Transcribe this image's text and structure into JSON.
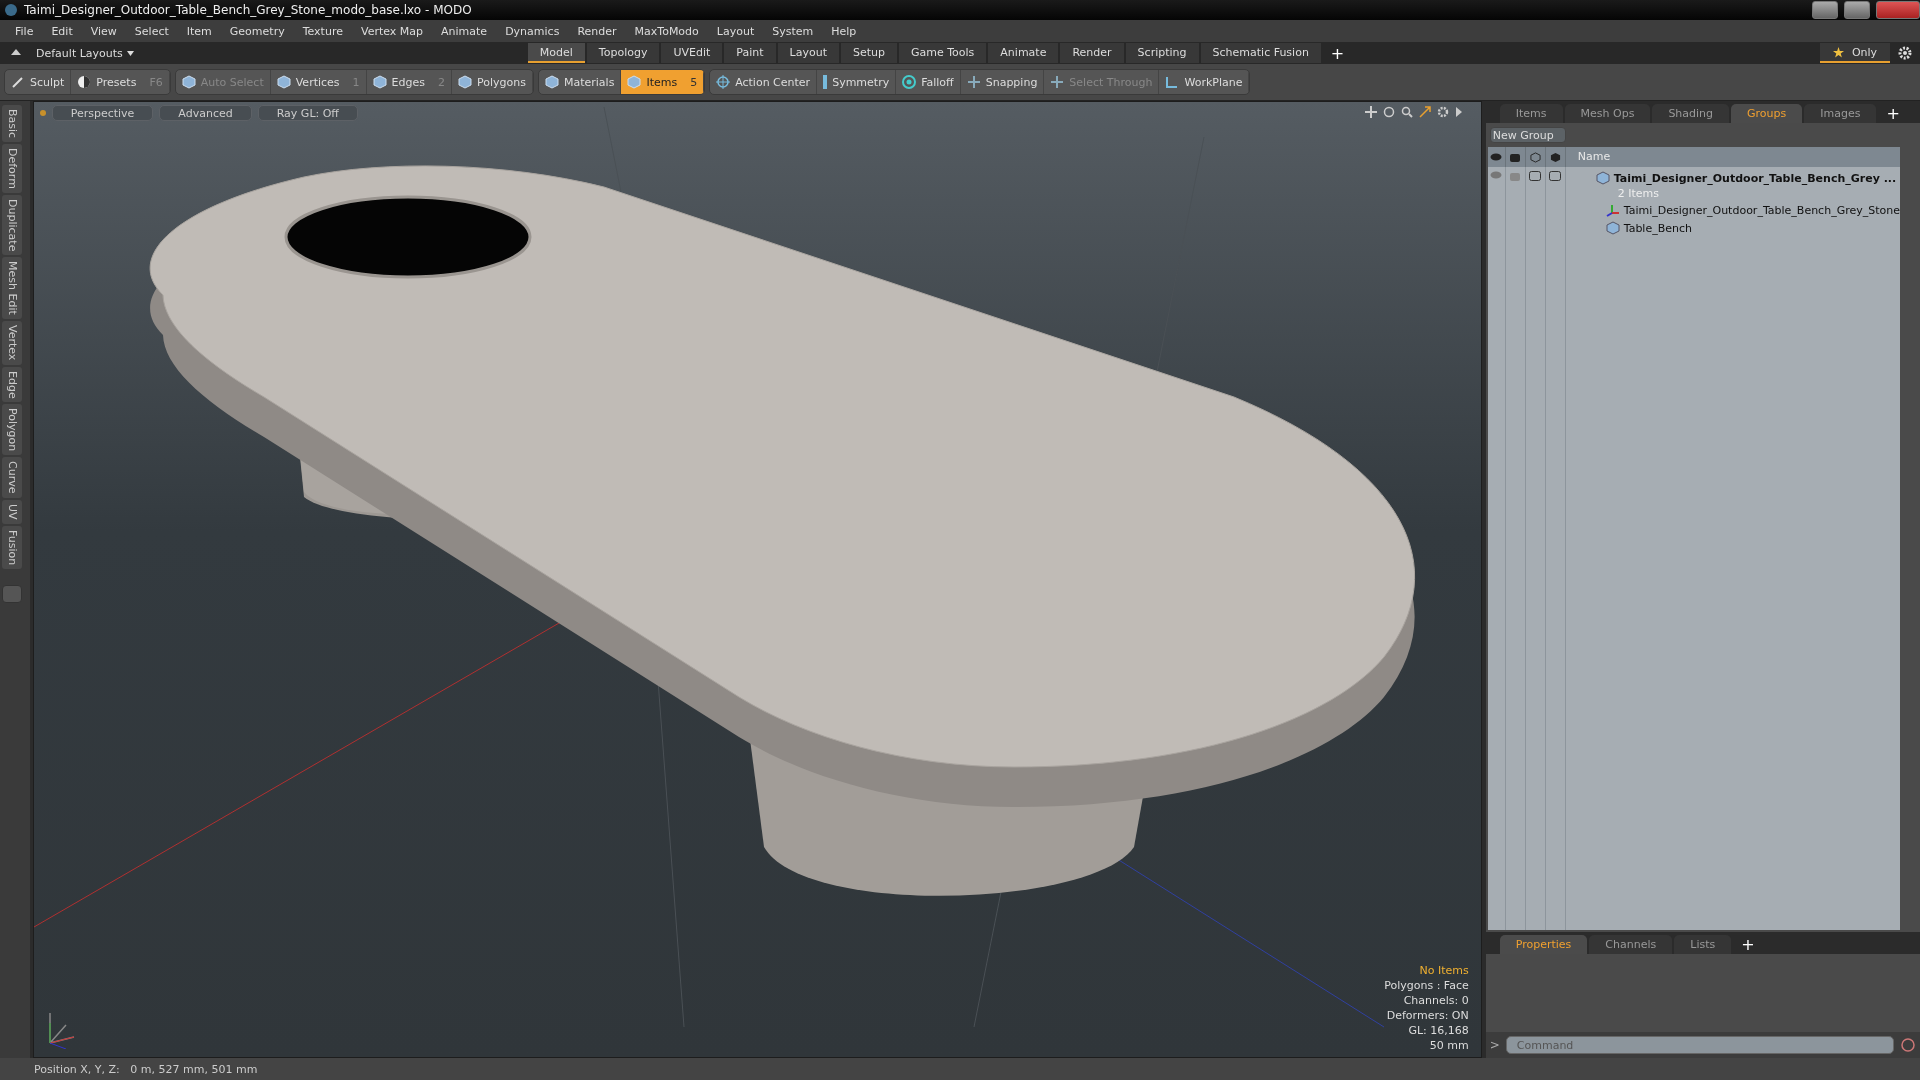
{
  "window": {
    "title": "Taimi_Designer_Outdoor_Table_Bench_Grey_Stone_modo_base.lxo - MODO"
  },
  "menu": [
    "File",
    "Edit",
    "View",
    "Select",
    "Item",
    "Geometry",
    "Texture",
    "Vertex Map",
    "Animate",
    "Dynamics",
    "Render",
    "MaxToModo",
    "Layout",
    "System",
    "Help"
  ],
  "layout_bar": {
    "layout_menu": "Default Layouts",
    "tabs": [
      {
        "label": "Model",
        "selected": true
      },
      {
        "label": "Topology",
        "selected": false
      },
      {
        "label": "UVEdit",
        "selected": false
      },
      {
        "label": "Paint",
        "selected": false
      },
      {
        "label": "Layout",
        "selected": false
      },
      {
        "label": "Setup",
        "selected": false
      },
      {
        "label": "Game Tools",
        "selected": false
      },
      {
        "label": "Animate",
        "selected": false
      },
      {
        "label": "Render",
        "selected": false
      },
      {
        "label": "Scripting",
        "selected": false
      },
      {
        "label": "Schematic Fusion",
        "selected": false
      }
    ],
    "add": "+",
    "only": "Only"
  },
  "toolbar": [
    [
      {
        "label": "Sculpt",
        "selected": false,
        "disabled": false
      },
      {
        "label": "Presets",
        "shortcut": "F6",
        "selected": false,
        "disabled": false
      }
    ],
    [
      {
        "label": "Auto Select",
        "selected": false,
        "disabled": true
      },
      {
        "label": "Vertices",
        "shortcut": "1",
        "selected": false,
        "disabled": false
      },
      {
        "label": "Edges",
        "shortcut": "2",
        "selected": false,
        "disabled": false
      },
      {
        "label": "Polygons",
        "selected": false,
        "disabled": false
      }
    ],
    [
      {
        "label": "Materials",
        "selected": false,
        "disabled": false
      },
      {
        "label": "Items",
        "shortcut": "5",
        "selected": true,
        "disabled": false
      }
    ],
    [
      {
        "label": "Action Center",
        "selected": false,
        "disabled": false
      },
      {
        "label": "Symmetry",
        "selected": false,
        "disabled": false
      },
      {
        "label": "Falloff",
        "selected": false,
        "disabled": false
      },
      {
        "label": "Snapping",
        "selected": false,
        "disabled": false
      },
      {
        "label": "Select Through",
        "selected": false,
        "disabled": true
      },
      {
        "label": "WorkPlane",
        "selected": false,
        "disabled": false
      }
    ]
  ],
  "side_tabs": [
    "Basic",
    "Deform",
    "Duplicate",
    "Mesh Edit",
    "Vertex",
    "Edge",
    "Polygon",
    "Curve",
    "UV",
    "Fusion"
  ],
  "viewport": {
    "buttons": [
      "Perspective",
      "Advanced",
      "Ray GL: Off"
    ],
    "info": [
      {
        "text": "No Items",
        "kind": "highlight"
      },
      {
        "text": "Polygons : Face",
        "kind": "normal"
      },
      {
        "text": "Channels: 0",
        "kind": "normal"
      },
      {
        "text": "Deformers: ON",
        "kind": "normal"
      },
      {
        "text": "GL: 16,168",
        "kind": "normal"
      },
      {
        "text": "50 mm",
        "kind": "normal"
      }
    ]
  },
  "status_bar": {
    "position": "Position X, Y, Z:   0 m, 527 mm, 501 mm"
  },
  "right_panel": {
    "tabs": [
      {
        "label": "Items",
        "selected": false
      },
      {
        "label": "Mesh Ops",
        "selected": false
      },
      {
        "label": "Shading",
        "selected": false
      },
      {
        "label": "Groups",
        "selected": true
      },
      {
        "label": "Images",
        "selected": false
      }
    ],
    "add": "+",
    "new_group": "New Group",
    "column": "Name",
    "tree": {
      "name": "Taimi_Designer_Outdoor_Table_Bench_Grey ...",
      "subtitle": "2 Items",
      "children": [
        {
          "name": "Taimi_Designer_Outdoor_Table_Bench_Grey_Stone",
          "kind": "locator"
        },
        {
          "name": "Table_Bench",
          "kind": "mesh"
        }
      ]
    }
  },
  "bottom_panel": {
    "tabs": [
      {
        "label": "Properties",
        "selected": true
      },
      {
        "label": "Channels",
        "selected": false
      },
      {
        "label": "Lists",
        "selected": false
      }
    ],
    "add": "+",
    "prompt": ">",
    "command_placeholder": "Command"
  }
}
